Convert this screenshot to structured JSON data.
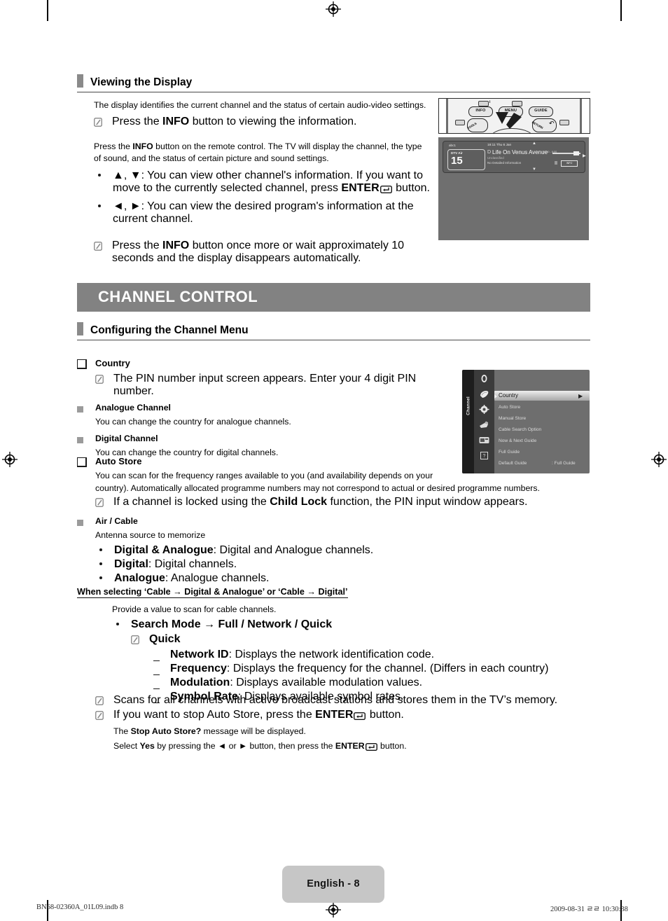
{
  "page": {
    "language_page": "English - 8",
    "footer_left": "BN68-02360A_01L09.indb   8",
    "footer_right": "2009-08-31   ㄹㄹ 10:30:38",
    "band_color": "#828282",
    "marker_color": "#8a8a8a",
    "badge_color": "#c6c6c6"
  },
  "viewing": {
    "title": "Viewing the Display",
    "intro": "The display identifies the current channel and the status of certain audio-video settings.",
    "note1_a": "Press the ",
    "note1_b": "INFO",
    "note1_c": " button to viewing the information.",
    "para2_a": "Press the ",
    "para2_b": "INFO",
    "para2_c": " button on the remote control. The TV will display the channel, the type of sound, and the status of certain picture and sound settings.",
    "bullet1_a": "▲, ▼: You can view other channel's information. If you want to move to the currently selected channel, press ",
    "bullet1_b": "ENTER",
    "bullet1_c": " button.",
    "bullet2": "◄, ►: You can view the desired program's information at the current channel.",
    "note2_a": "Press the ",
    "note2_b": "INFO",
    "note2_c": " button once more or wait approximately 10 seconds and the display disappears automatically."
  },
  "remote": {
    "info_label": "INFO",
    "menu_label": "MENU",
    "guide_label": "GUIDE",
    "tools_label": "TOOLS",
    "return_label": "RETURN",
    "mini_left": "P",
    "mini_right": "P"
  },
  "tv_banner": {
    "channel_name": "abc1",
    "time": "18:11 Thu 6 Jan",
    "source": "DTV Air",
    "channel_number": "15",
    "program_icon": "D",
    "program_title": "Life On Venus Avenue",
    "program_time": "18:00 - 6:00",
    "rating": "Unclassified",
    "details": "No Detailed Information",
    "info_badge": "INFO"
  },
  "channel_control": {
    "band_title": "CHANNEL CONTROL",
    "section_title": "Configuring the Channel Menu"
  },
  "country": {
    "heading": "Country",
    "note": "The PIN number input screen appears. Enter your 4 digit PIN number.",
    "sub1_title": "Analogue Channel",
    "sub1_body": "You can change the country for analogue channels.",
    "sub2_title": "Digital Channel",
    "sub2_body": "You can change the country for digital channels."
  },
  "osd": {
    "rail_label": "Channel",
    "items": [
      {
        "label": "Country",
        "value": "",
        "selected": true
      },
      {
        "label": "Auto Store",
        "value": "",
        "selected": false
      },
      {
        "label": "Manual Store",
        "value": "",
        "selected": false
      },
      {
        "label": "Cable Search Option",
        "value": "",
        "selected": false
      },
      {
        "label": "Now & Next Guide",
        "value": "",
        "selected": false
      },
      {
        "label": "Full Guide",
        "value": "",
        "selected": false
      },
      {
        "label": "Default Guide",
        "value": ": Full Guide",
        "selected": false
      }
    ]
  },
  "auto_store": {
    "heading": "Auto Store",
    "body_line1": "You can scan for the frequency ranges available to you (and availability depends on your",
    "body_line2": "country). Automatically allocated programme numbers may not correspond to actual or desired programme numbers.",
    "note_a": "If a channel is locked using the ",
    "note_b": "Child Lock",
    "note_c": " function, the PIN input window appears.",
    "sub_title": "Air / Cable",
    "sub_body": "Antenna source to memorize",
    "options": [
      {
        "name": "Digital & Analogue",
        "desc": ": Digital and Analogue channels."
      },
      {
        "name": "Digital",
        "desc": ": Digital channels."
      },
      {
        "name": "Analogue",
        "desc": ": Analogue channels."
      }
    ]
  },
  "cable_section": {
    "heading": "When selecting ‘Cable → Digital & Analogue’ or ‘Cable → Digital’",
    "intro": "Provide a value to scan for cable channels.",
    "bullet": "Search Mode → Full / Network / Quick",
    "note": "Quick",
    "items": [
      {
        "name": "Network ID",
        "desc": ": Displays the network identification code."
      },
      {
        "name": "Frequency",
        "desc": ": Displays the frequency for the channel. (Differs in each country)"
      },
      {
        "name": "Modulation",
        "desc": ": Displays available modulation values."
      },
      {
        "name": "Symbol Rate",
        "desc": ": Displays available symbol rates."
      }
    ]
  },
  "closing_notes": {
    "note1": "Scans for all channels with active broadcast stations and stores them in the TV’s memory.",
    "note2_a": "If you want to stop Auto Store, press the ",
    "note2_b": "ENTER",
    "note2_c": " button.",
    "note2_line2_a": "The ",
    "note2_line2_b": "Stop Auto Store?",
    "note2_line2_c": " message will be displayed.",
    "note2_line3_a": "Select ",
    "note2_line3_b": "Yes",
    "note2_line3_c": " by pressing the ◄ or ► button, then press the ",
    "note2_line3_d": "ENTER",
    "note2_line3_e": " button."
  }
}
